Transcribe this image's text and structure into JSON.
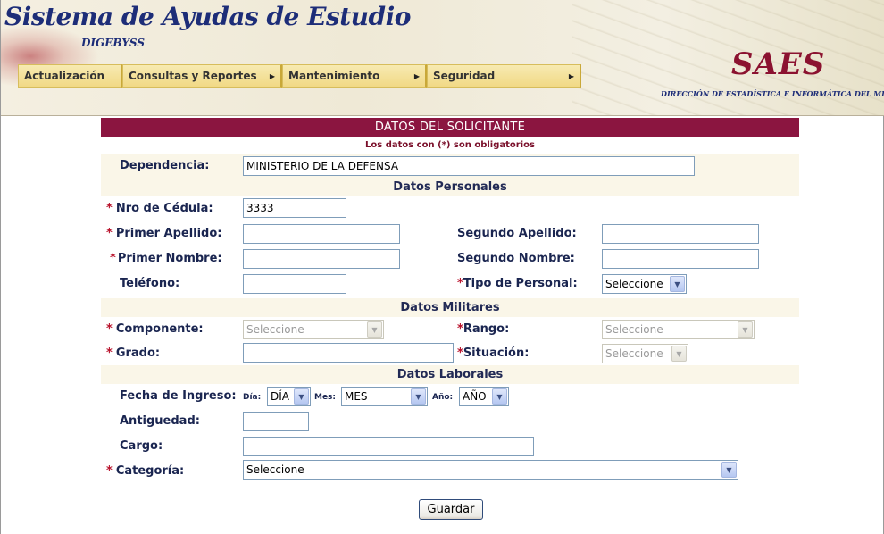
{
  "header": {
    "title": "Sistema de Ayudas de Estudio",
    "subtitle": "DIGEBYSS",
    "logo_text": "SAES",
    "logo_subtitle": "DIRECCIÓN DE ESTADÍSTICA E INFORMÁTICA DEL MD"
  },
  "menu": {
    "items": [
      {
        "label": "Actualización",
        "has_submenu": false
      },
      {
        "label": "Consultas y Reportes",
        "has_submenu": true
      },
      {
        "label": "Mantenimiento",
        "has_submenu": true
      },
      {
        "label": "Seguridad",
        "has_submenu": true
      }
    ],
    "arrow_glyph": "▶"
  },
  "form": {
    "title": "DATOS DEL SOLICITANTE",
    "notice": "Los datos con (*) son obligatorios",
    "required_mark": "*",
    "dependencia": {
      "label": "Dependencia:",
      "value": "MINISTERIO DE LA DEFENSA"
    },
    "personales": {
      "heading": "Datos Personales",
      "cedula": {
        "label": "Nro de Cédula:",
        "value": "3333"
      },
      "primer_apellido": {
        "label": "Primer Apellido:",
        "value": ""
      },
      "segundo_apellido": {
        "label": "Segundo Apellido:",
        "value": ""
      },
      "primer_nombre": {
        "label": "Primer Nombre:",
        "value": ""
      },
      "segundo_nombre": {
        "label": "Segundo Nombre:",
        "value": ""
      },
      "telefono": {
        "label": "Teléfono:",
        "value": ""
      },
      "tipo_personal": {
        "label": "Tipo de Personal:",
        "value": "Seleccione"
      }
    },
    "militares": {
      "heading": "Datos Militares",
      "componente": {
        "label": "Componente:",
        "value": "Seleccione"
      },
      "rango": {
        "label": "Rango:",
        "value": "Seleccione"
      },
      "grado": {
        "label": "Grado:",
        "value": ""
      },
      "situacion": {
        "label": "Situación:",
        "value": "Seleccione"
      }
    },
    "laborales": {
      "heading": "Datos Laborales",
      "fecha_ingreso": {
        "label": "Fecha de Ingreso:",
        "dia_label": "Día:",
        "dia_value": "DÍA",
        "mes_label": "Mes:",
        "mes_value": "MES",
        "anio_label": "Año:",
        "anio_value": "AÑO"
      },
      "antiguedad": {
        "label": "Antiguedad:",
        "value": ""
      },
      "cargo": {
        "label": "Cargo:",
        "value": ""
      },
      "categoria": {
        "label": "Categoría:",
        "value": "Seleccione"
      }
    },
    "save_label": "Guardar",
    "dropdown_glyph": "▼"
  },
  "colors": {
    "form_title_bg": "#8b1540",
    "section_bg": "#faf6e8",
    "label_text": "#1a2550",
    "required": "#b8102a",
    "menu_bg": "#f1d985",
    "brand_blue": "#1d2d78",
    "logo_red": "#8b1230"
  },
  "icons": {
    "dropdown": "chevron-down-icon",
    "submenu": "triangle-right-icon"
  }
}
